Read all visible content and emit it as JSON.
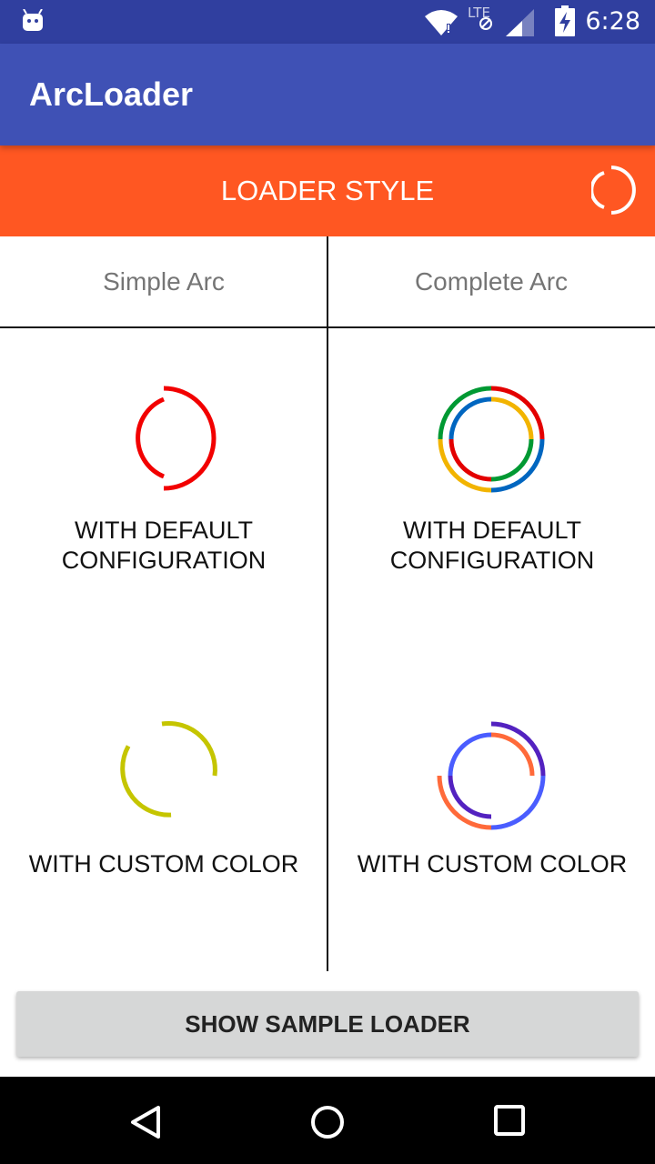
{
  "status_bar": {
    "time": "6:28",
    "network_label": "LTE",
    "icons": [
      "android-notification-icon",
      "wifi-icon",
      "lte-icon",
      "signal-icon",
      "battery-charging-icon"
    ]
  },
  "app_bar": {
    "title": "ArcLoader"
  },
  "style_bar": {
    "label": "LOADER STYLE",
    "icon": "arc-loader-icon"
  },
  "columns": [
    {
      "header": "Simple Arc"
    },
    {
      "header": "Complete Arc"
    }
  ],
  "cells": {
    "simple_default": {
      "caption_line1": "WITH DEFAULT",
      "caption_line2": "CONFIGURATION",
      "colors": [
        "#F20000"
      ]
    },
    "complete_default": {
      "caption_line1": "WITH DEFAULT",
      "caption_line2": "CONFIGURATION",
      "colors": [
        "#E30000",
        "#0066C0",
        "#F2B400",
        "#009933"
      ]
    },
    "simple_custom": {
      "caption": "WITH CUSTOM COLOR",
      "colors": [
        "#C5C500"
      ]
    },
    "complete_custom": {
      "caption": "WITH CUSTOM COLOR",
      "colors": [
        "#5322C0",
        "#FF6A3A",
        "#4A5DFF"
      ]
    }
  },
  "button": {
    "label": "SHOW SAMPLE LOADER"
  },
  "nav_bar": {
    "icons": [
      "back-icon",
      "home-icon",
      "recents-icon"
    ]
  },
  "colors": {
    "status_bar": "#303F9F",
    "app_bar": "#3F51B5",
    "accent": "#FF5722",
    "button": "#D6D7D7"
  }
}
